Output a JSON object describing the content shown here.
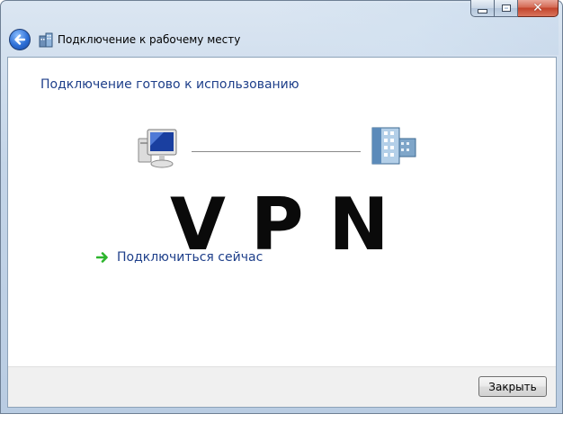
{
  "window": {
    "title": "Подключение к рабочему месту",
    "controls": {
      "minimize_icon": "minimize-icon",
      "maximize_icon": "maximize-icon",
      "close_glyph": "✕"
    }
  },
  "content": {
    "heading": "Подключение готово к использованию",
    "watermark": "VPN",
    "action_label": "Подключиться сейчас",
    "icons": [
      "computer-icon",
      "server-icon",
      "green-arrow-icon",
      "back-arrow-icon",
      "workplace-icon"
    ]
  },
  "footer": {
    "close_label": "Закрыть"
  },
  "colors": {
    "heading": "#1e3f8a",
    "arrow": "#2db52d",
    "watermark": "#0a0a0a"
  }
}
